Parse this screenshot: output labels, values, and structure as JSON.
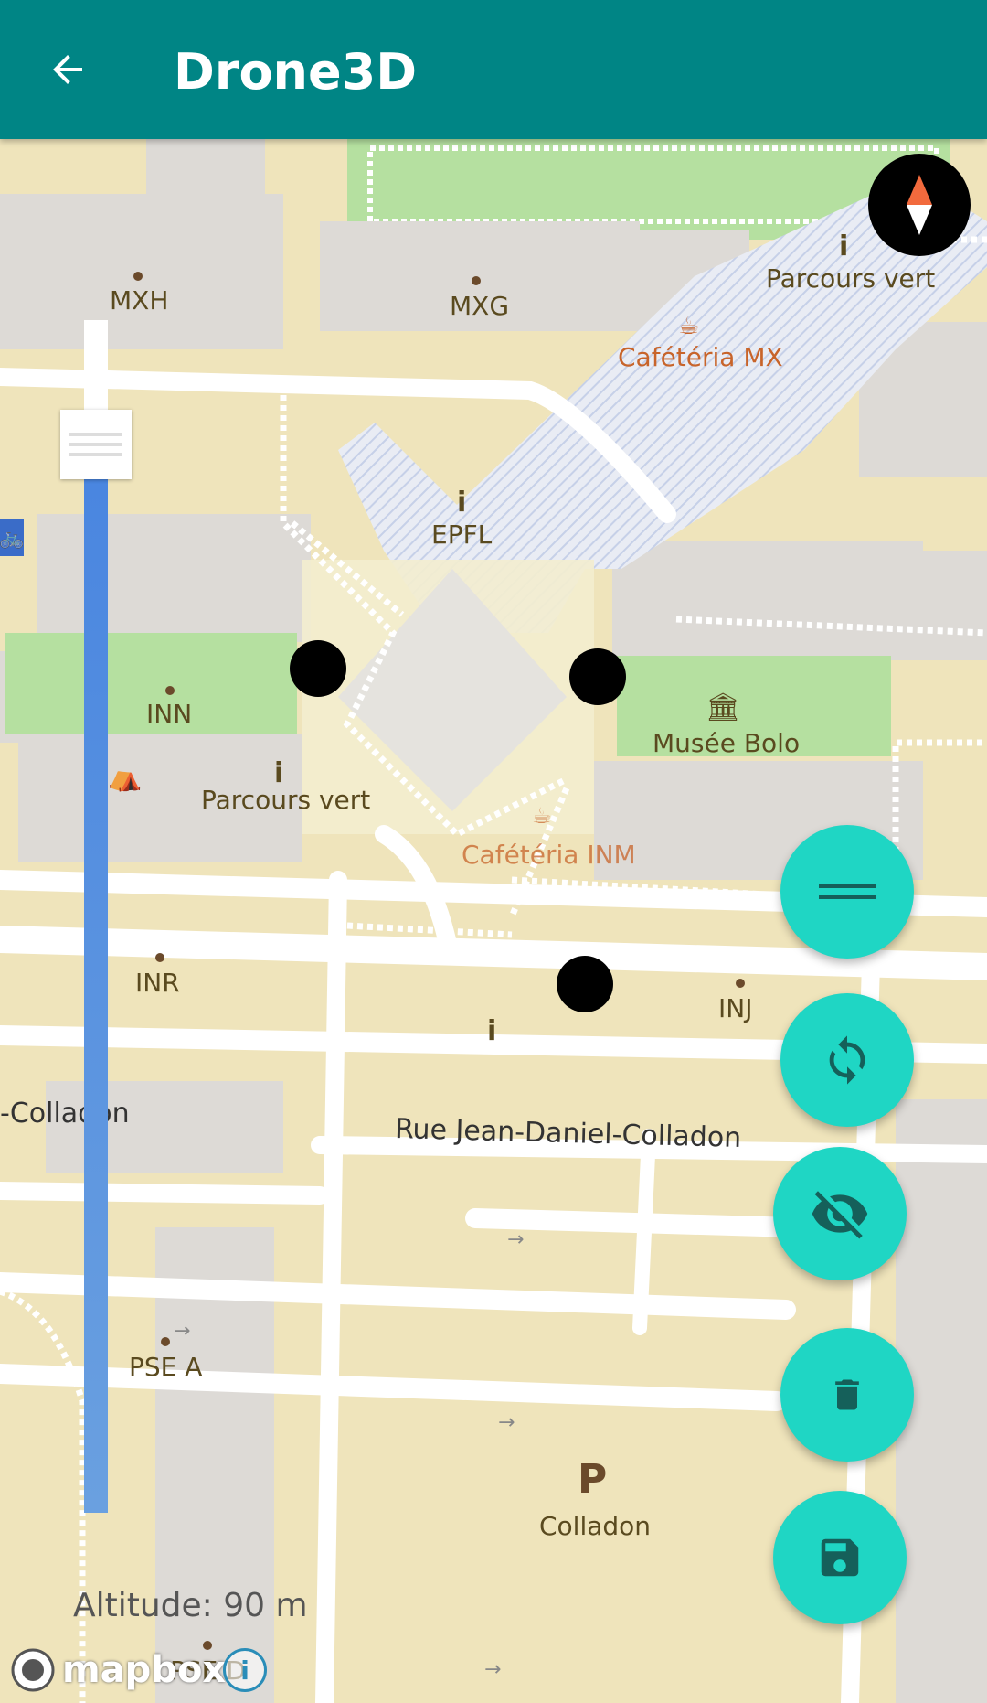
{
  "appbar": {
    "title": "Drone3D",
    "back_icon": "arrow-left-icon"
  },
  "colors": {
    "appbar": "#008585",
    "fab": "#1fd6c4",
    "slider": "#4a86e0",
    "marker": "#000000"
  },
  "map": {
    "labels": {
      "mxh": "MXH",
      "mxg": "MXG",
      "parcours_vert_top": "Parcours vert",
      "cafeteria_mx": "Cafétéria MX",
      "epfl": "EPFL",
      "inn": "INN",
      "musee_bolo": "Musée Bolo",
      "parcours_vert_mid": "Parcours vert",
      "cafeteria_inm": "Cafétéria INM",
      "inr": "INR",
      "inj": "INJ",
      "street_left": "-Colladon",
      "street_main": "Rue Jean-Daniel-Colladon",
      "pse_a": "PSE A",
      "parking_p": "P",
      "colladon": "Colladon",
      "pse_d": "PSE D"
    }
  },
  "altitude": {
    "text": "Altitude: 90 m",
    "value_m": 90
  },
  "fabs": {
    "menu": "menu-icon",
    "sync": "sync-icon",
    "hide": "eye-off-icon",
    "delete": "trash-icon",
    "save": "floppy-disk-icon"
  },
  "branding": {
    "mapbox": "mapbox",
    "info": "i"
  }
}
